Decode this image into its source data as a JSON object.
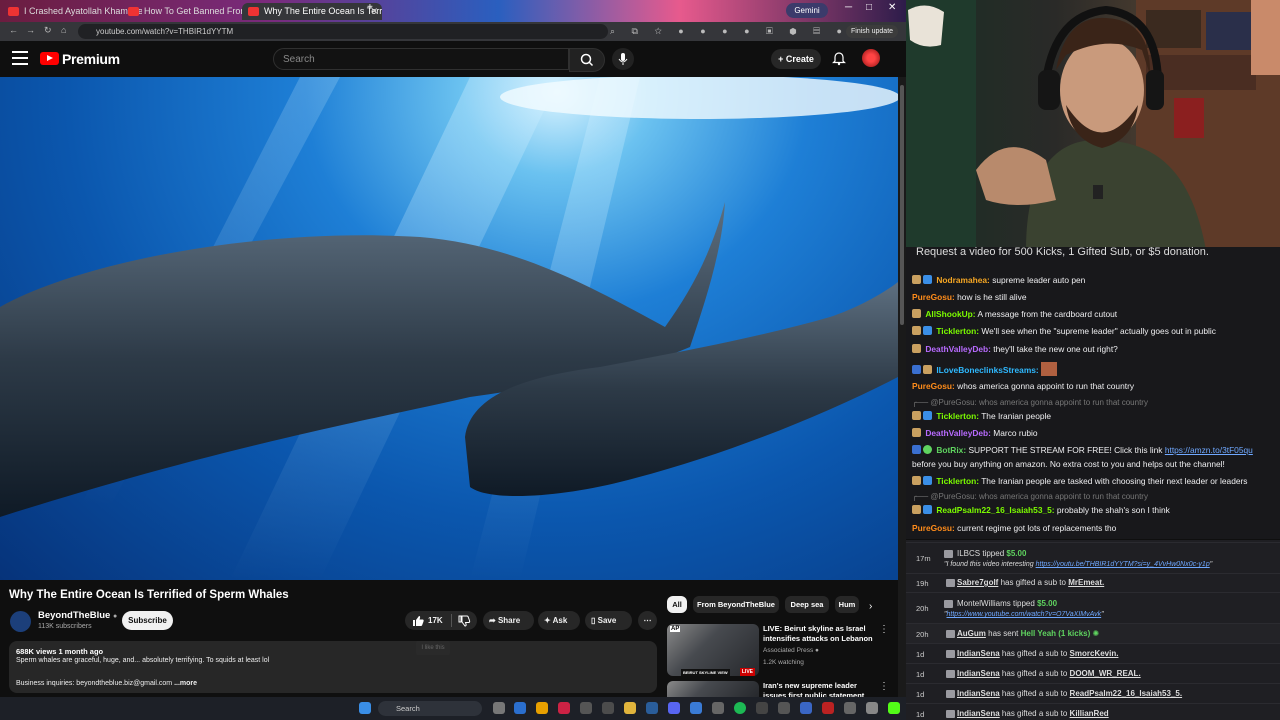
{
  "browser": {
    "tabs": [
      {
        "label": "I Crashed Ayatollah Khamenei's"
      },
      {
        "label": "How To Get Banned From MGM"
      },
      {
        "label": "Why The Entire Ocean Is Terrif"
      }
    ],
    "gemini_label": "Gemini",
    "url": "youtube.com/watch?v=THBIR1dYYTM",
    "finish_update_label": "Finish update"
  },
  "youtube": {
    "logo_text": "Premium",
    "search_placeholder": "Search",
    "create_label": "Create"
  },
  "video": {
    "title": "Why The Entire Ocean Is Terrified of Sperm Whales",
    "channel": "BeyondTheBlue",
    "subscribers": "113K subscribers",
    "subscribe_label": "Subscribe",
    "likes": "17K",
    "like_tooltip": "I like this",
    "share_label": "Share",
    "ask_label": "Ask",
    "save_label": "Save",
    "views_age": "688K views  1 month ago",
    "description": "Sperm whales are graceful, huge, and... absolutely terrifying. To squids at least lol",
    "business": "Business inquiries: beyondtheblue.biz@gmail.com",
    "more_label": "...more"
  },
  "chips": [
    "All",
    "From BeyondTheBlue",
    "Deep sea",
    "Hum"
  ],
  "related": [
    {
      "title": "LIVE: Beirut skyline as Israel intensifies attacks on Lebanon",
      "channel": "Associated Press",
      "meta": "1.2K watching",
      "badge": "LIVE",
      "thumb_caption": "BEIRUT SKYLINE VIEW",
      "thumb_logo": "AP"
    },
    {
      "title": "Iran's new supreme leader issues first public statement"
    }
  ],
  "taskbar": {
    "search_label": "Search"
  },
  "chat": {
    "banner": "Request a video for 500 Kicks, 1 Gifted Sub, or $5 donation.",
    "messages": [
      {
        "user": "Nodramahea:",
        "text": "supreme leader auto pen",
        "color": "#f5a623"
      },
      {
        "user": "PureGosu:",
        "text": "how is he still alive",
        "color": "#ff8c1a"
      },
      {
        "user": "AllShookUp:",
        "text": "A message from the cardboard cutout",
        "color": "#7cfc00"
      },
      {
        "user": "Ticklerton:",
        "text": "We'll see when the \"supreme leader\" actually goes out in public",
        "color": "#7cfc00"
      },
      {
        "user": "DeathValleyDeb:",
        "text": "they'll take the new one out right?",
        "color": "#b86bff"
      },
      {
        "user": "ILoveBoneclinksStreams:",
        "text": "",
        "color": "#2fb9ff"
      },
      {
        "user": "PureGosu:",
        "text": "whos america gonna appoint to run that country",
        "color": "#ff8c1a"
      },
      {
        "reply": "@PureGosu: whos america gonna appoint to run that country"
      },
      {
        "user": "Ticklerton:",
        "text": "The Iranian people",
        "color": "#7cfc00"
      },
      {
        "user": "DeathValleyDeb:",
        "text": "Marco rubio",
        "color": "#b86bff"
      },
      {
        "user": "BotRix:",
        "text": "SUPPORT THE STREAM FOR FREE! Click this link",
        "link": "https://amzn.to/3tF05qu",
        "color": "#5fd35f"
      },
      {
        "text": "before you buy anything on amazon. No extra cost to you and helps out the channel!"
      },
      {
        "user": "Ticklerton:",
        "text": "The Iranian people are tasked with choosing their next leader or leaders",
        "color": "#7cfc00"
      },
      {
        "reply": "@PureGosu: whos america gonna appoint to run that country"
      },
      {
        "user": "ReadPsalm22_16_Isaiah53_5:",
        "text": "probably the shah's son I think",
        "color": "#7cfc00"
      },
      {
        "user": "PureGosu:",
        "text": "current regime got lots of replacements tho",
        "color": "#ff8c1a"
      }
    ]
  },
  "events": [
    {
      "time": "17m",
      "user": "ILBCS",
      "action": "tipped",
      "amount": "$5.00",
      "note": "\"I found this video interesting",
      "link": "https://youtu.be/THBIR1dYYTM?si=y_4VvHw0Nx0c-y1p",
      "note_end": "\""
    },
    {
      "time": "19h",
      "user": "Sabre7golf",
      "action": "has gifted a sub to",
      "target": "MrEmeat."
    },
    {
      "time": "20h",
      "user": "MontelWilliams",
      "action": "tipped",
      "amount": "$5.00",
      "note": "\"",
      "link": "https://www.youtube.com/watch?v=O7VaXIMvAvk",
      "note_end": "\""
    },
    {
      "time": "20h",
      "user": "AuGum",
      "action": "has sent",
      "target": "Hell Yeah (1 kicks)"
    },
    {
      "time": "1d",
      "user": "IndianSena",
      "action": "has gifted a sub to",
      "target": "SmorcKevin."
    },
    {
      "time": "1d",
      "user": "IndianSena",
      "action": "has gifted a sub to",
      "target": "DOOM_WR_REAL."
    },
    {
      "time": "1d",
      "user": "IndianSena",
      "action": "has gifted a sub to",
      "target": "ReadPsalm22_16_Isaiah53_5."
    },
    {
      "time": "1d",
      "user": "IndianSena",
      "action": "has gifted a sub to",
      "target": "KillianRed"
    }
  ]
}
